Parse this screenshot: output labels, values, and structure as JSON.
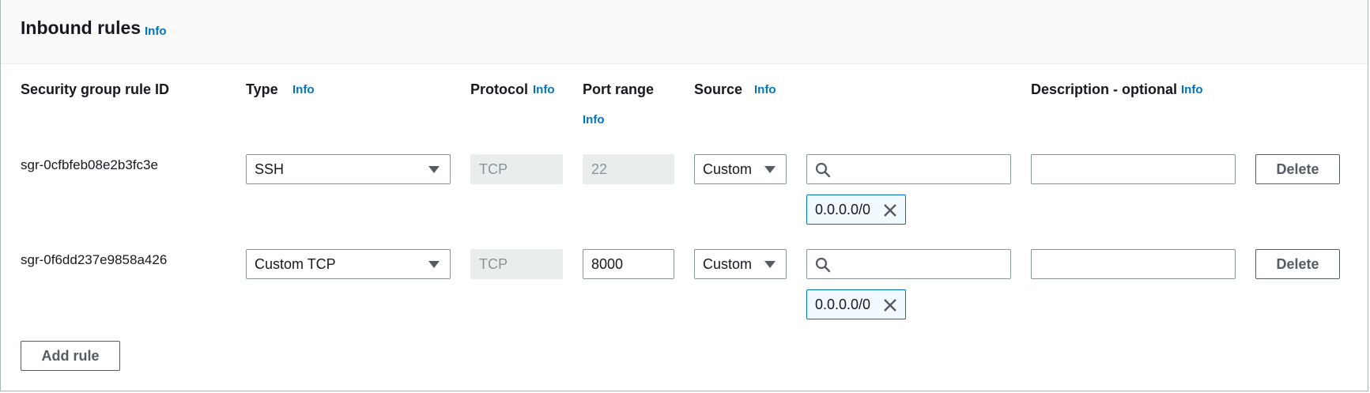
{
  "header": {
    "title": "Inbound rules",
    "info": "Info"
  },
  "columns": {
    "rule_id": "Security group rule ID",
    "type": "Type",
    "type_info": "Info",
    "protocol": "Protocol",
    "protocol_info": "Info",
    "port_range": "Port range",
    "port_range_info": "Info",
    "source": "Source",
    "source_info": "Info",
    "description": "Description - optional",
    "description_info": "Info"
  },
  "rules": [
    {
      "id": "sgr-0cfbfeb08e2b3fc3e",
      "type": "SSH",
      "protocol": "TCP",
      "port_range": "22",
      "source": "Custom",
      "source_search": "",
      "cidr": "0.0.0.0/0",
      "description": "",
      "delete_label": "Delete"
    },
    {
      "id": "sgr-0f6dd237e9858a426",
      "type": "Custom TCP",
      "protocol": "TCP",
      "port_range": "8000",
      "source": "Custom",
      "source_search": "",
      "cidr": "0.0.0.0/0",
      "description": "",
      "delete_label": "Delete"
    }
  ],
  "add_rule_label": "Add rule",
  "colors": {
    "link": "#0073bb",
    "border": "#879596",
    "disabled": "#eaeded",
    "token_bg": "#f1faff"
  },
  "icons": {
    "search": "search-icon",
    "close": "close-icon",
    "caret": "caret-down-icon"
  }
}
